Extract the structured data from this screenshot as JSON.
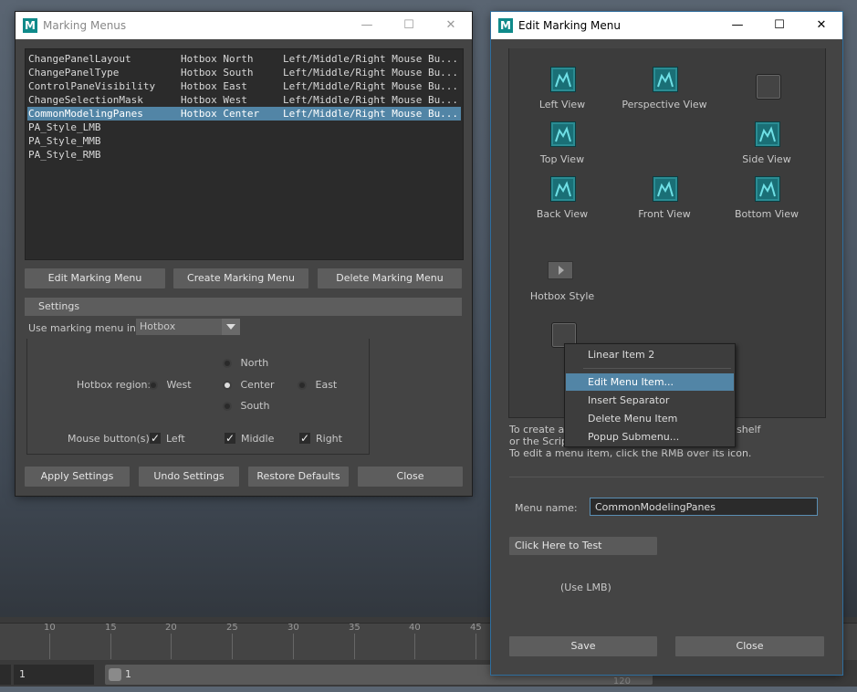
{
  "marking_menus": {
    "title": "Marking Menus",
    "window_controls": {
      "minimize": "—",
      "maximize": "☐",
      "close": "✕"
    },
    "list_rows": [
      {
        "name": "ChangePanelLayout",
        "location": "Hotbox North",
        "trigger": "Left/Middle/Right Mouse Bu..."
      },
      {
        "name": "ChangePanelType",
        "location": "Hotbox South",
        "trigger": "Left/Middle/Right Mouse Bu..."
      },
      {
        "name": "ControlPaneVisibility",
        "location": "Hotbox East",
        "trigger": "Left/Middle/Right Mouse Bu..."
      },
      {
        "name": "ChangeSelectionMask",
        "location": "Hotbox West",
        "trigger": "Left/Middle/Right Mouse Bu..."
      },
      {
        "name": "CommonModelingPanes",
        "location": "Hotbox Center",
        "trigger": "Left/Middle/Right Mouse Bu..."
      },
      {
        "name": "PA_Style_LMB",
        "location": "",
        "trigger": ""
      },
      {
        "name": "PA_Style_MMB",
        "location": "",
        "trigger": ""
      },
      {
        "name": "PA_Style_RMB",
        "location": "",
        "trigger": ""
      }
    ],
    "selected_row": 4,
    "buttons": {
      "edit": "Edit Marking Menu",
      "create": "Create Marking Menu",
      "delete": "Delete Marking Menu"
    },
    "settings": {
      "header": "Settings",
      "use_in_label": "Use marking menu in:",
      "use_in_value": "Hotbox",
      "hotbox_region_label": "Hotbox region:",
      "regions": {
        "north": "North",
        "west": "West",
        "center": "Center",
        "east": "East",
        "south": "South"
      },
      "selected_region": "Center",
      "mouse_buttons_label": "Mouse button(s):",
      "mouse_buttons": {
        "left": "Left",
        "middle": "Middle",
        "right": "Right"
      },
      "checked": [
        "Left",
        "Middle",
        "Right"
      ]
    },
    "bottom_buttons": {
      "apply": "Apply Settings",
      "undo": "Undo Settings",
      "restore": "Restore Defaults",
      "close": "Close"
    }
  },
  "edit_marking_menu": {
    "title": "Edit Marking Menu",
    "window_controls": {
      "minimize": "—",
      "maximize": "☐",
      "close": "✕"
    },
    "items": {
      "left_view": "Left View",
      "perspective_view": "Perspective View",
      "top_view": "Top View",
      "side_view": "Side View",
      "back_view": "Back View",
      "front_view": "Front View",
      "bottom_view": "Bottom View",
      "hotbox_style": "Hotbox Style"
    },
    "help_line1": "To create a n",
    "help_line1_tail": "shelf",
    "help_line2": "or the Script",
    "help_line3": "To edit a menu item, click the RMB over its icon.",
    "menu_name_label": "Menu name:",
    "menu_name_value": "CommonModelingPanes",
    "test_button": "Click Here to Test",
    "use_lmb": "(Use LMB)",
    "save": "Save",
    "close": "Close",
    "context_menu": {
      "header": "Linear Item 2",
      "items": [
        "Edit Menu Item...",
        "Insert Separator",
        "Delete Menu Item",
        "Popup Submenu..."
      ],
      "highlighted": 0
    }
  },
  "timeline": {
    "ticks": [
      "10",
      "15",
      "20",
      "25",
      "30",
      "35",
      "40",
      "45"
    ],
    "start_frame": "1",
    "range_start": "1",
    "range_end": "120"
  },
  "colors": {
    "accent": "#5285a6",
    "panel": "#444444",
    "icon_teal": "#1a6f76"
  }
}
